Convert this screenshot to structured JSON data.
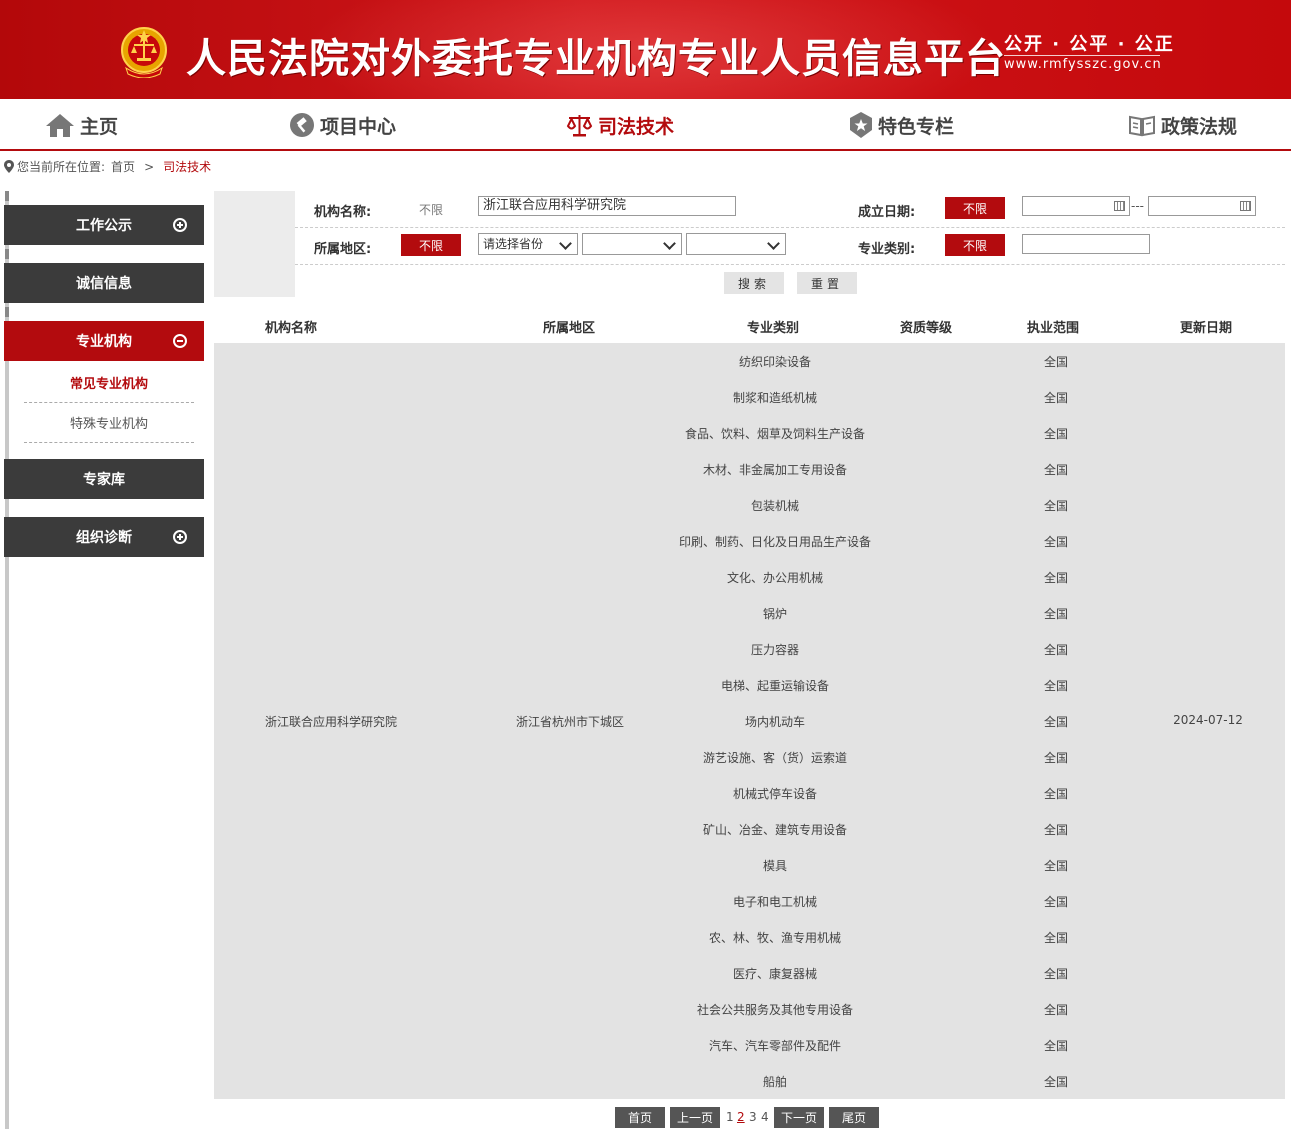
{
  "header": {
    "title": "人民法院对外委托专业机构专业人员信息平台",
    "slogan": "公开 · 公平 · 公正",
    "url": "www.rmfysszc.gov.cn",
    "emblem_icon": "court-emblem-icon"
  },
  "nav": {
    "items": [
      {
        "label": "主页",
        "icon": "home-icon"
      },
      {
        "label": "项目中心",
        "icon": "gavel-icon"
      },
      {
        "label": "司法技术",
        "icon": "scales-icon",
        "active": true
      },
      {
        "label": "特色专栏",
        "icon": "star-shield-icon"
      },
      {
        "label": "政策法规",
        "icon": "book-icon"
      }
    ]
  },
  "breadcrumb": {
    "prefix": "您当前所在位置:",
    "home": "首页",
    "separator": ">",
    "current": "司法技术"
  },
  "sidebar": {
    "menus": [
      {
        "label": "工作公示",
        "toggle": "plus"
      },
      {
        "label": "诚信信息",
        "toggle": ""
      },
      {
        "label": "专业机构",
        "toggle": "minus",
        "active": true
      },
      {
        "label": "专家库",
        "toggle": ""
      },
      {
        "label": "组织诊断",
        "toggle": "plus"
      }
    ],
    "submenu": [
      {
        "label": "常见专业机构",
        "active": true
      },
      {
        "label": "特殊专业机构"
      }
    ]
  },
  "filters": {
    "org_name_label": "机构名称:",
    "org_name_any": "不限",
    "org_name_value": "浙江联合应用科学研究院",
    "found_date_label": "成立日期:",
    "found_date_any": "不限",
    "date_separator": "---",
    "region_label": "所属地区:",
    "region_any": "不限",
    "province_placeholder": "请选择省份",
    "city_value": "",
    "district_value": "",
    "category_label": "专业类别:",
    "category_any": "不限",
    "category_value": "",
    "search_button": "搜索",
    "reset_button": "重置"
  },
  "table": {
    "headers": [
      "机构名称",
      "所属地区",
      "专业类别",
      "资质等级",
      "执业范围",
      "更新日期"
    ],
    "org_name": "浙江联合应用科学研究院",
    "region": "浙江省杭州市下城区",
    "update_date": "2024-07-12",
    "rows": [
      {
        "category": "纺织印染设备",
        "scope": "全国"
      },
      {
        "category": "制浆和造纸机械",
        "scope": "全国"
      },
      {
        "category": "食品、饮料、烟草及饲料生产设备",
        "scope": "全国"
      },
      {
        "category": "木材、非金属加工专用设备",
        "scope": "全国"
      },
      {
        "category": "包装机械",
        "scope": "全国"
      },
      {
        "category": "印刷、制药、日化及日用品生产设备",
        "scope": "全国"
      },
      {
        "category": "文化、办公用机械",
        "scope": "全国"
      },
      {
        "category": "锅炉",
        "scope": "全国"
      },
      {
        "category": "压力容器",
        "scope": "全国"
      },
      {
        "category": "电梯、起重运输设备",
        "scope": "全国"
      },
      {
        "category": "场内机动车",
        "scope": "全国"
      },
      {
        "category": "游艺设施、客（货）运索道",
        "scope": "全国"
      },
      {
        "category": "机械式停车设备",
        "scope": "全国"
      },
      {
        "category": "矿山、冶金、建筑专用设备",
        "scope": "全国"
      },
      {
        "category": "模具",
        "scope": "全国"
      },
      {
        "category": "电子和电工机械",
        "scope": "全国"
      },
      {
        "category": "农、林、牧、渔专用机械",
        "scope": "全国"
      },
      {
        "category": "医疗、康复器械",
        "scope": "全国"
      },
      {
        "category": "社会公共服务及其他专用设备",
        "scope": "全国"
      },
      {
        "category": "汽车、汽车零部件及配件",
        "scope": "全国"
      },
      {
        "category": "船舶",
        "scope": "全国"
      }
    ]
  },
  "pagination": {
    "first": "首页",
    "prev": "上一页",
    "pages": [
      "1",
      "2",
      "3",
      "4"
    ],
    "current": "2",
    "next": "下一页",
    "last": "尾页"
  }
}
